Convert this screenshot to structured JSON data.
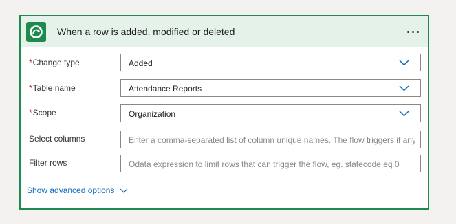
{
  "header": {
    "icon": "dataverse-logo-icon",
    "title": "When a row is added, modified or deleted",
    "more_label": "···",
    "accent_color": "#1e8a50"
  },
  "fields": {
    "change_type": {
      "label": "Change type",
      "required_mark": "*",
      "value": "Added"
    },
    "table_name": {
      "label": "Table name",
      "required_mark": "*",
      "value": "Attendance Reports"
    },
    "scope": {
      "label": "Scope",
      "required_mark": "*",
      "value": "Organization"
    },
    "select_columns": {
      "label": "Select columns",
      "placeholder": "Enter a comma-separated list of column unique names. The flow triggers if any"
    },
    "filter_rows": {
      "label": "Filter rows",
      "placeholder": "Odata expression to limit rows that can trigger the flow, eg. statecode eq 0"
    }
  },
  "advanced": {
    "label": "Show advanced options"
  }
}
